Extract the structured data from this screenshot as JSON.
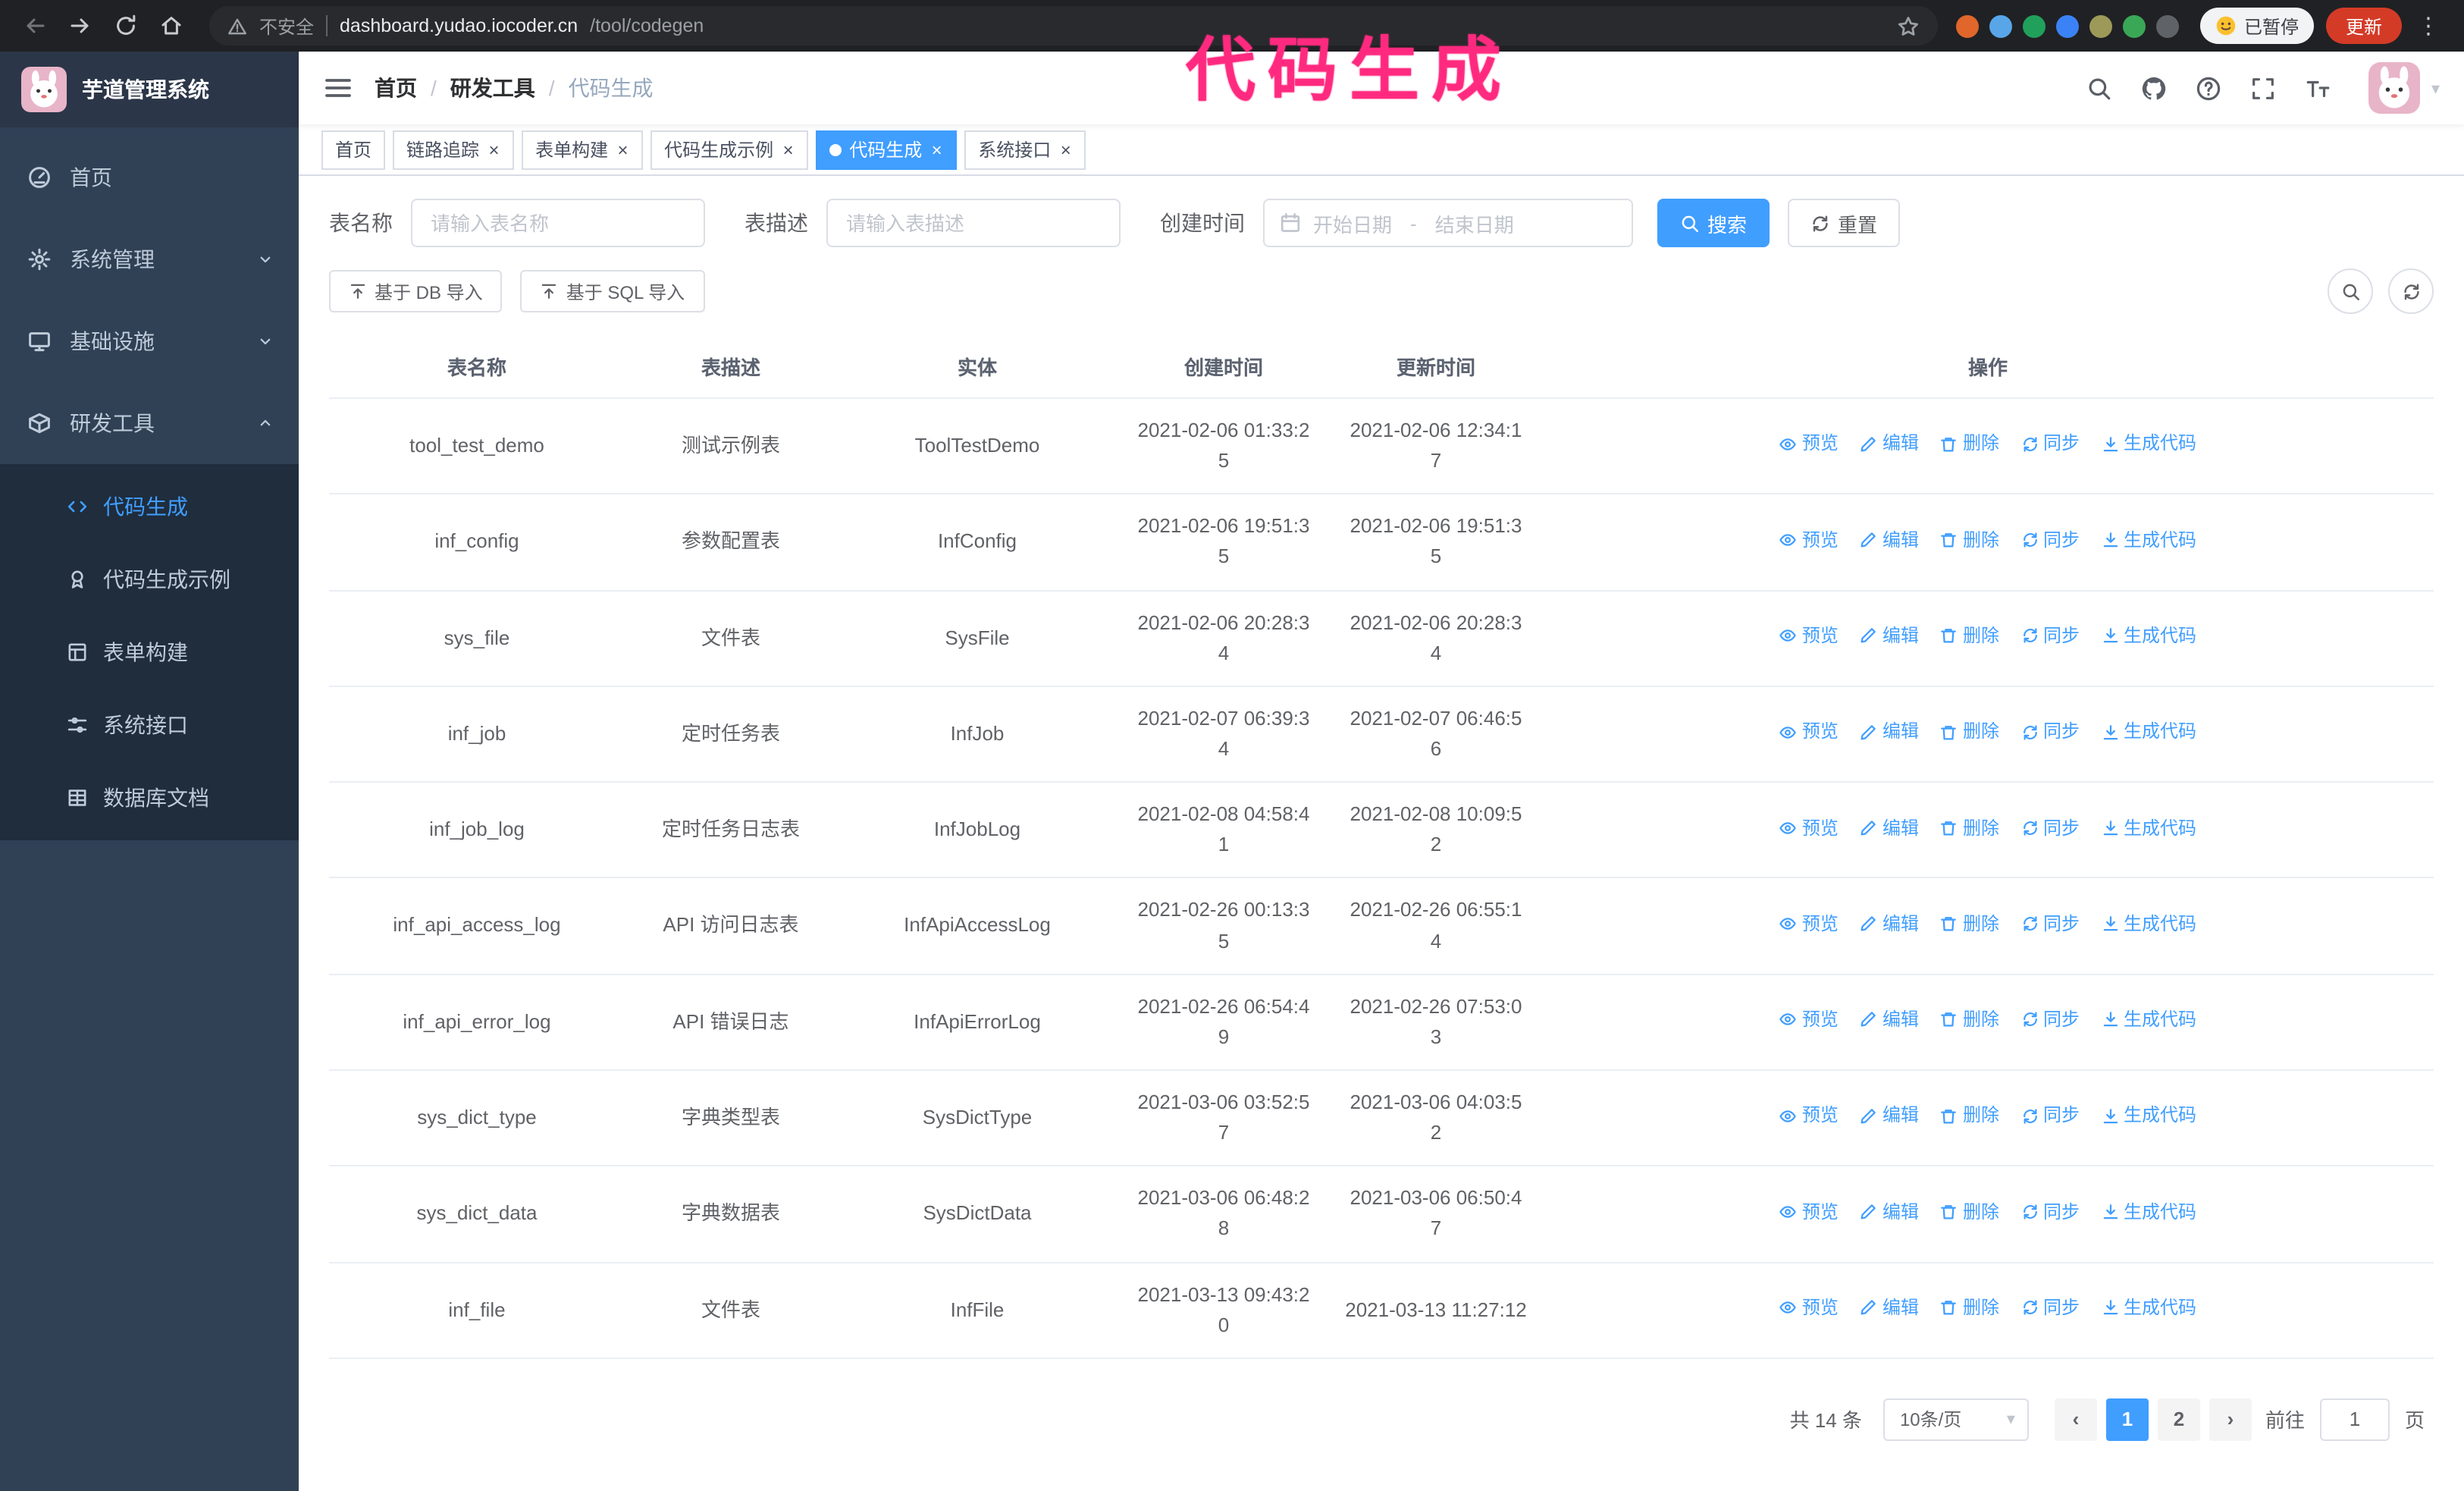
{
  "theme": {
    "accent": "#409eff",
    "sidebar_bg": "#304156",
    "submenu_bg": "#1f2d3d",
    "annotation_color": "#ff2a7f"
  },
  "annotation": {
    "text": "代码生成"
  },
  "browser": {
    "security_label": "不安全",
    "url_host": "dashboard.yudao.iocoder.cn",
    "url_path": "/tool/codegen",
    "paused_badge": "已暂停",
    "update_button": "更新",
    "extensions": [
      {
        "name": "extension-icon",
        "color": "#e0662b"
      },
      {
        "name": "extension-icon",
        "color": "#58a6e8"
      },
      {
        "name": "extension-icon",
        "color": "#21a05c"
      },
      {
        "name": "extension-icon",
        "color": "#3b82f6"
      },
      {
        "name": "extension-icon",
        "color": "#9d9a59"
      },
      {
        "name": "extension-icon",
        "color": "#3aa757"
      },
      {
        "name": "extension-icon",
        "color": "#5f6368"
      }
    ]
  },
  "sidebar": {
    "logo_title": "芋道管理系统",
    "menu": [
      {
        "key": "home",
        "label": "首页",
        "icon": "dashboard"
      },
      {
        "key": "system",
        "label": "系统管理",
        "icon": "gear",
        "chevron": "down"
      },
      {
        "key": "infra",
        "label": "基础设施",
        "icon": "monitor",
        "chevron": "down"
      },
      {
        "key": "devtools",
        "label": "研发工具",
        "icon": "box",
        "chevron": "up",
        "children": [
          {
            "key": "codegen",
            "label": "代码生成",
            "icon": "code",
            "active": true
          },
          {
            "key": "codegen-demo",
            "label": "代码生成示例",
            "icon": "medal"
          },
          {
            "key": "form-builder",
            "label": "表单构建",
            "icon": "form"
          },
          {
            "key": "api",
            "label": "系统接口",
            "icon": "sliders"
          },
          {
            "key": "db-doc",
            "label": "数据库文档",
            "icon": "grid"
          }
        ]
      }
    ]
  },
  "header": {
    "breadcrumb": [
      "首页",
      "研发工具",
      "代码生成"
    ],
    "icons": [
      "search",
      "github",
      "question",
      "fullscreen",
      "fontsize"
    ]
  },
  "tabs": [
    {
      "label": "首页",
      "closable": false
    },
    {
      "label": "链路追踪",
      "closable": true
    },
    {
      "label": "表单构建",
      "closable": true
    },
    {
      "label": "代码生成示例",
      "closable": true
    },
    {
      "label": "代码生成",
      "closable": true,
      "active": true
    },
    {
      "label": "系统接口",
      "closable": true
    }
  ],
  "filters": {
    "table_name_label": "表名称",
    "table_name_placeholder": "请输入表名称",
    "table_desc_label": "表描述",
    "table_desc_placeholder": "请输入表描述",
    "create_time_label": "创建时间",
    "date_start_placeholder": "开始日期",
    "date_separator": "-",
    "date_end_placeholder": "结束日期",
    "search_button": "搜索",
    "reset_button": "重置"
  },
  "toolbar": {
    "import_db": "基于 DB 导入",
    "import_sql": "基于 SQL 导入"
  },
  "table": {
    "columns": [
      "表名称",
      "表描述",
      "实体",
      "创建时间",
      "更新时间",
      "操作"
    ],
    "actions": [
      {
        "key": "preview",
        "label": "预览",
        "icon": "eye"
      },
      {
        "key": "edit",
        "label": "编辑",
        "icon": "edit"
      },
      {
        "key": "delete",
        "label": "删除",
        "icon": "trash"
      },
      {
        "key": "sync",
        "label": "同步",
        "icon": "sync"
      },
      {
        "key": "generate",
        "label": "生成代码",
        "icon": "download"
      }
    ],
    "rows": [
      {
        "name": "tool_test_demo",
        "desc": "测试示例表",
        "entity": "ToolTestDemo",
        "created": "2021-02-06 01:33:25",
        "updated": "2021-02-06 12:34:17"
      },
      {
        "name": "inf_config",
        "desc": "参数配置表",
        "entity": "InfConfig",
        "created": "2021-02-06 19:51:35",
        "updated": "2021-02-06 19:51:35"
      },
      {
        "name": "sys_file",
        "desc": "文件表",
        "entity": "SysFile",
        "created": "2021-02-06 20:28:34",
        "updated": "2021-02-06 20:28:34"
      },
      {
        "name": "inf_job",
        "desc": "定时任务表",
        "entity": "InfJob",
        "created": "2021-02-07 06:39:34",
        "updated": "2021-02-07 06:46:56"
      },
      {
        "name": "inf_job_log",
        "desc": "定时任务日志表",
        "entity": "InfJobLog",
        "created": "2021-02-08 04:58:41",
        "updated": "2021-02-08 10:09:52"
      },
      {
        "name": "inf_api_access_log",
        "desc": "API 访问日志表",
        "entity": "InfApiAccessLog",
        "created": "2021-02-26 00:13:35",
        "updated": "2021-02-26 06:55:14"
      },
      {
        "name": "inf_api_error_log",
        "desc": "API 错误日志",
        "entity": "InfApiErrorLog",
        "created": "2021-02-26 06:54:49",
        "updated": "2021-02-26 07:53:03"
      },
      {
        "name": "sys_dict_type",
        "desc": "字典类型表",
        "entity": "SysDictType",
        "created": "2021-03-06 03:52:57",
        "updated": "2021-03-06 04:03:52"
      },
      {
        "name": "sys_dict_data",
        "desc": "字典数据表",
        "entity": "SysDictData",
        "created": "2021-03-06 06:48:28",
        "updated": "2021-03-06 06:50:47"
      },
      {
        "name": "inf_file",
        "desc": "文件表",
        "entity": "InfFile",
        "created": "2021-03-13 09:43:20",
        "updated": "2021-03-13 11:27:12"
      }
    ]
  },
  "pagination": {
    "total_text": "共 14 条",
    "page_size": "10条/页",
    "pages": [
      {
        "label": "1",
        "active": true
      },
      {
        "label": "2",
        "active": false
      }
    ],
    "goto_label": "前往",
    "goto_value": "1",
    "goto_unit": "页"
  }
}
